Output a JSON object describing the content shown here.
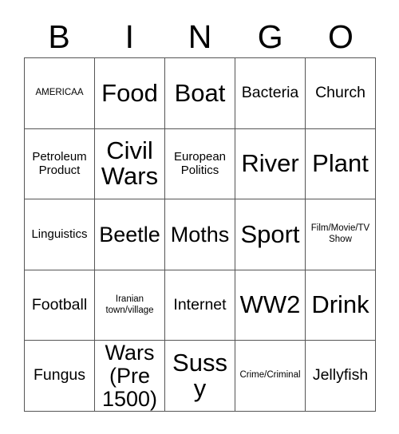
{
  "card": {
    "title": "BINGO",
    "header_letters": [
      "B",
      "I",
      "N",
      "G",
      "O"
    ],
    "rows": 5,
    "columns": 5,
    "border_color": "#555555",
    "text_color": "#000000",
    "background_color": "#ffffff",
    "cells": [
      [
        {
          "text": "AMERICAA",
          "size": "xs"
        },
        {
          "text": "Food",
          "size": "xl"
        },
        {
          "text": "Boat",
          "size": "xl"
        },
        {
          "text": "Bacteria",
          "size": "md"
        },
        {
          "text": "Church",
          "size": "md"
        }
      ],
      [
        {
          "text": "Petroleum Product",
          "size": "sm"
        },
        {
          "text": "Civil Wars",
          "size": "xl"
        },
        {
          "text": "European Politics",
          "size": "sm"
        },
        {
          "text": "River",
          "size": "xl"
        },
        {
          "text": "Plant",
          "size": "xl"
        }
      ],
      [
        {
          "text": "Linguistics",
          "size": "sm"
        },
        {
          "text": "Beetle",
          "size": "lg"
        },
        {
          "text": "Moths",
          "size": "lg"
        },
        {
          "text": "Sport",
          "size": "xl"
        },
        {
          "text": "Film/Movie/TV Show",
          "size": "xs"
        }
      ],
      [
        {
          "text": "Football",
          "size": "md"
        },
        {
          "text": "Iranian town/village",
          "size": "xs"
        },
        {
          "text": "Internet",
          "size": "md"
        },
        {
          "text": "WW2",
          "size": "xl"
        },
        {
          "text": "Drink",
          "size": "xl"
        }
      ],
      [
        {
          "text": "Fungus",
          "size": "md"
        },
        {
          "text": "Wars (Pre 1500)",
          "size": "lg"
        },
        {
          "text": "Sussy",
          "size": "xl"
        },
        {
          "text": "Crime/Criminal",
          "size": "xs"
        },
        {
          "text": "Jellyfish",
          "size": "md"
        }
      ]
    ]
  }
}
